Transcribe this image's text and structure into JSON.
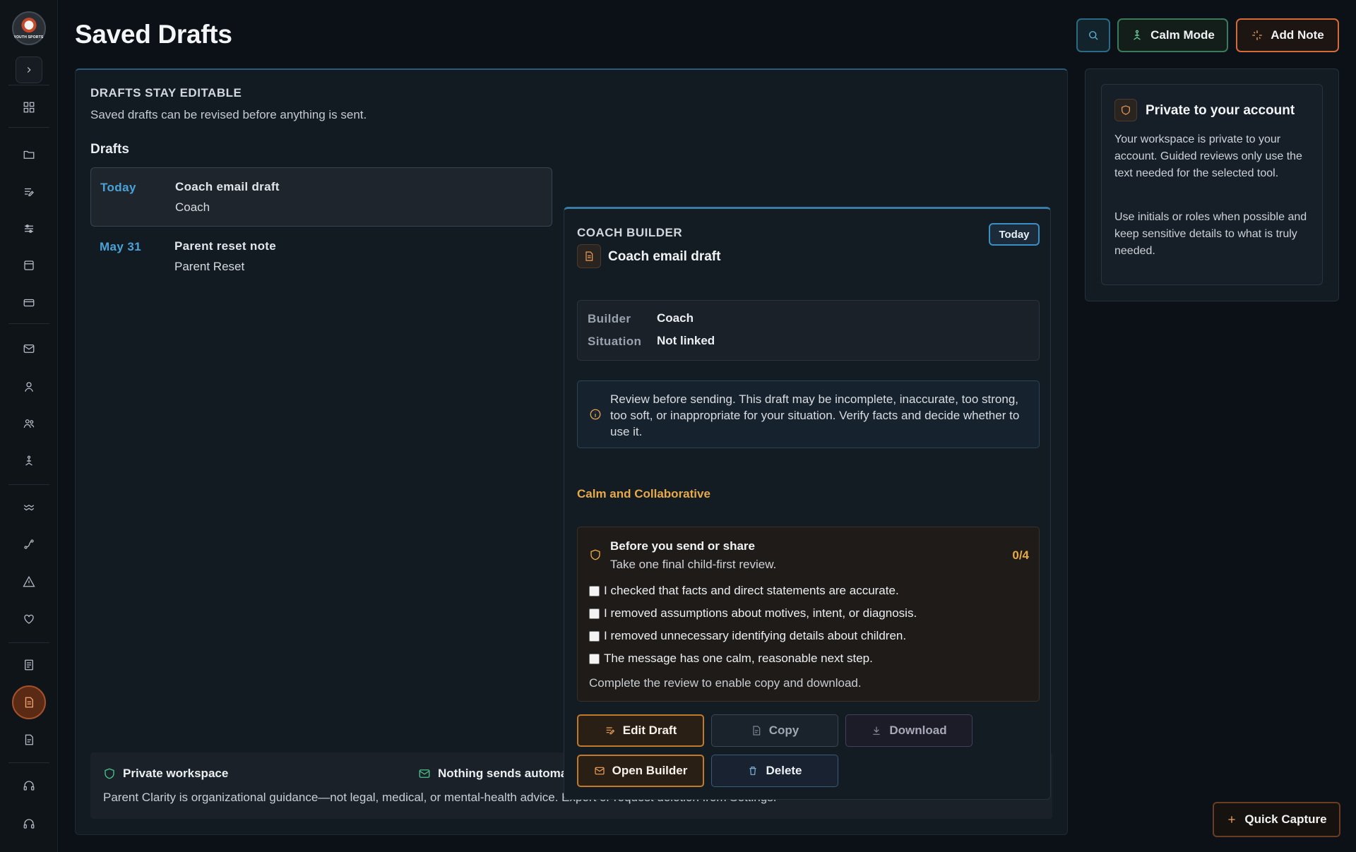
{
  "app": {
    "logo_text": "YOUTH SPORTS",
    "title": "Saved Drafts"
  },
  "header": {
    "calm_mode": "Calm Mode",
    "add_note": "Add Note",
    "accent": "#d46a3a"
  },
  "intro": {
    "kicker": "DRAFTS STAY EDITABLE",
    "subtitle": "Saved drafts can be revised before anything is sent.",
    "list_label": "Drafts"
  },
  "drafts": [
    {
      "date": "Today",
      "title": "Coach email draft",
      "type": "Coach"
    },
    {
      "date": "May 31",
      "title": "Parent reset note",
      "type": "Parent Reset"
    }
  ],
  "detail": {
    "kicker": "COACH BUILDER",
    "badge": "Today",
    "title": "Coach email draft",
    "meta": [
      {
        "key": "Builder",
        "value": "Coach"
      },
      {
        "key": "Situation",
        "value": "Not linked"
      }
    ],
    "review_notice": "Review before sending. This draft may be incomplete, inaccurate, too strong, too soft, or inappropriate for your situation. Verify facts and decide whether to use it.",
    "tone": "Calm and Collaborative",
    "checklist": {
      "title": "Before you send or share",
      "subtitle": "Take one final child-first review.",
      "count": "0/4",
      "items": [
        "I checked that facts and direct statements are accurate.",
        "I removed assumptions about motives, intent, or diagnosis.",
        "I removed unnecessary identifying details about children.",
        "The message has one calm, reasonable next step."
      ],
      "footer": "Complete the review to enable copy and download."
    },
    "buttons": {
      "edit": "Edit Draft",
      "copy": "Copy",
      "download": "Download",
      "open": "Open Builder",
      "delete": "Delete"
    }
  },
  "footer": {
    "private": "Private workspace",
    "nothing_sends": "Nothing sends automat",
    "note": "Parent Clarity is organizational guidance—not legal, medical, or mental-health advice. Export or request deletion from Settings."
  },
  "side": {
    "title": "Private to your account",
    "p1": "Your workspace is private to your account. Guided reviews only use the text needed for the selected tool.",
    "p2": "Use initials or roles when possible and keep sensitive details to what is truly needed."
  },
  "quick_capture": "Quick Capture"
}
